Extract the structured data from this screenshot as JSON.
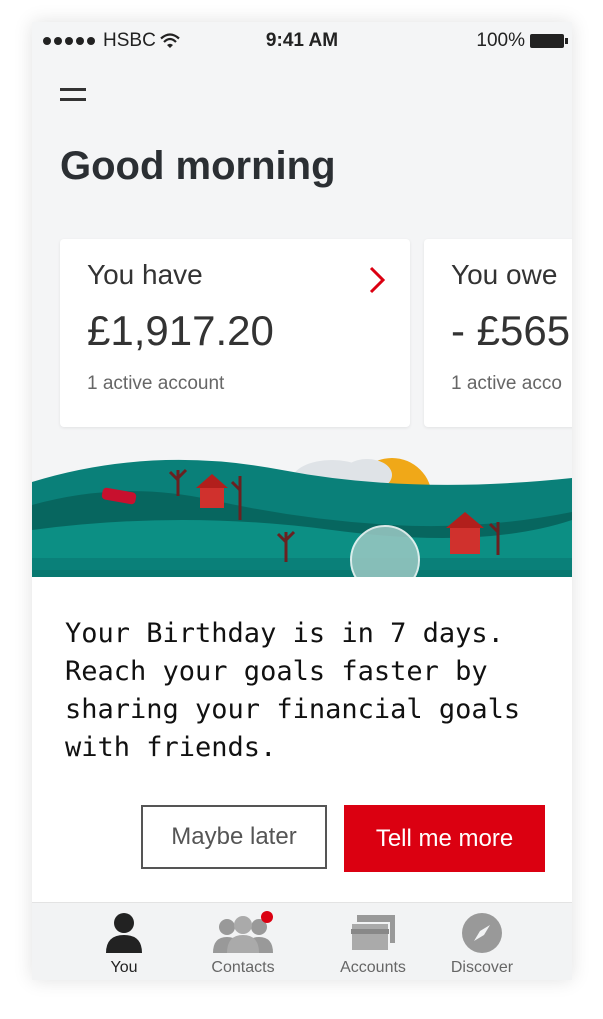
{
  "status_bar": {
    "carrier": "HSBC",
    "time": "9:41 AM",
    "battery": "100%"
  },
  "greeting": "Good morning",
  "cards": [
    {
      "label": "You have",
      "amount": "£1,917.20",
      "sub": "1 active account"
    },
    {
      "label": "You owe",
      "amount": "- £565",
      "sub": "1 active acco"
    }
  ],
  "promo": {
    "message": "Your Birthday is in 7 days. Reach your goals faster by sharing your financial goals with friends.",
    "secondary_button": "Maybe later",
    "primary_button": "Tell me more"
  },
  "tabs": [
    {
      "label": "You",
      "icon": "person-icon",
      "active": true
    },
    {
      "label": "Contacts",
      "icon": "contacts-icon",
      "badge": true
    },
    {
      "label": "Accounts",
      "icon": "accounts-icon"
    },
    {
      "label": "Discover",
      "icon": "compass-icon"
    }
  ],
  "colors": {
    "brand_red": "#db0011",
    "hill_teal": "#0a8079",
    "sun": "#f0a818"
  }
}
